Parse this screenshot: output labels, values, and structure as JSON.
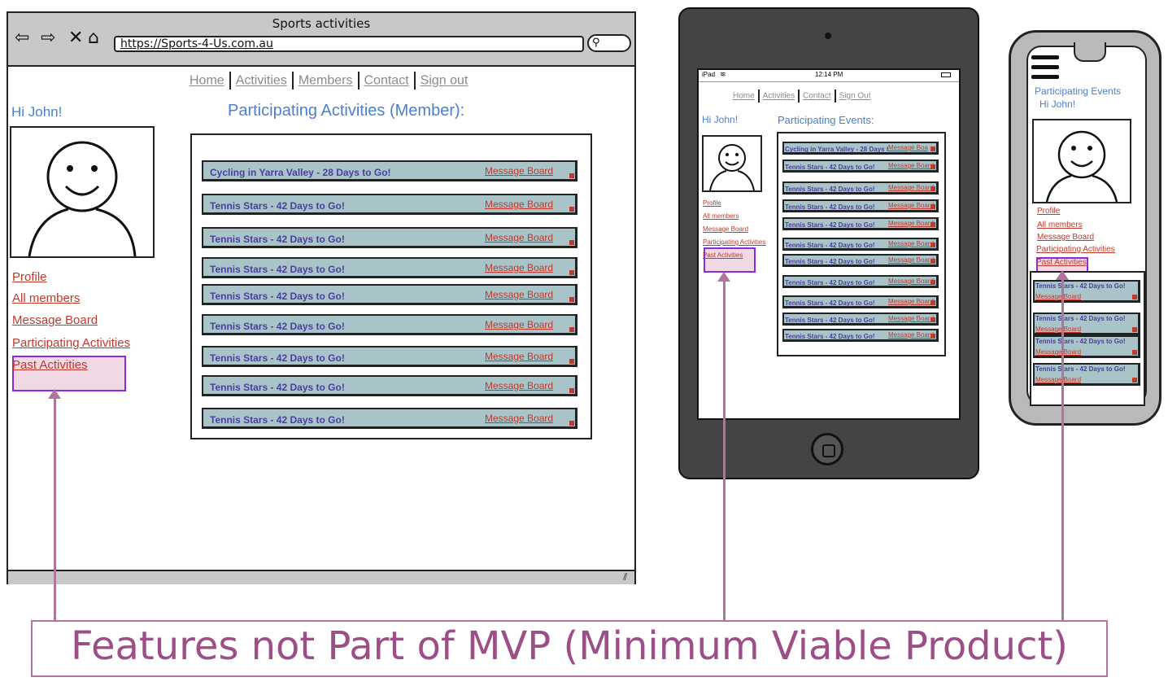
{
  "desktop": {
    "window_title": "Sports activities",
    "url": "https://Sports-4-Us.com.au",
    "icons": [
      "back-arrow-icon",
      "forward-arrow-icon",
      "close-icon",
      "home-icon",
      "search-icon"
    ],
    "nav": [
      "Home",
      "Activities",
      "Members",
      "Contact",
      "Sign out"
    ],
    "greeting": "Hi John!",
    "heading": "Participating Activities (Member):",
    "sidebar": [
      "Profile",
      "All members",
      "Message Board",
      "Participating Activities",
      "Past Activities"
    ],
    "activities": [
      {
        "name": "Cycling in Yarra Valley - 28 Days to Go!",
        "link": "Message Board"
      },
      {
        "name": "Tennis Stars - 42 Days to Go!",
        "link": "Message Board"
      },
      {
        "name": "Tennis Stars - 42 Days to Go!",
        "link": "Message Board"
      },
      {
        "name": "Tennis Stars - 42 Days to Go!",
        "link": "Message Board"
      },
      {
        "name": "Tennis Stars - 42 Days to Go!",
        "link": "Message Board"
      },
      {
        "name": "Tennis Stars - 42 Days to Go!",
        "link": "Message Board"
      },
      {
        "name": "Tennis Stars - 42 Days to Go!",
        "link": "Message Board"
      },
      {
        "name": "Tennis Stars - 42 Days to Go!",
        "link": "Message Board"
      },
      {
        "name": "Tennis Stars - 42 Days to Go!",
        "link": "Message Board"
      }
    ]
  },
  "tablet": {
    "status_left": "iPad",
    "status_time": "12:14 PM",
    "nav": [
      "Home",
      "Activities",
      "Contact",
      "Sign Out"
    ],
    "greeting": "Hi John!",
    "heading": "Participating Events:",
    "sidebar": [
      "Profile",
      "All members",
      "Message Board",
      "Participating Activities",
      "Past Activities"
    ],
    "activities": [
      {
        "name": "Cycling in Yarra Valley - 28 Days t",
        "link": "Message Boa"
      },
      {
        "name": "Tennis Stars - 42 Days to Go!",
        "link": "Message Board"
      },
      {
        "name": "Tennis Stars - 42 Days to Go!",
        "link": "Message Board"
      },
      {
        "name": "Tennis Stars - 42 Days to Go!",
        "link": "Message Board"
      },
      {
        "name": "Tennis Stars - 42 Days to Go!",
        "link": "Message Board"
      },
      {
        "name": "Tennis Stars - 42 Days to Go!",
        "link": "Message Board"
      },
      {
        "name": "Tennis Stars - 42 Days to Go!",
        "link": "Message Board"
      },
      {
        "name": "Tennis Stars - 42 Days to Go!",
        "link": "Message Board"
      },
      {
        "name": "Tennis Stars - 42 Days to Go!",
        "link": "Message Board"
      },
      {
        "name": "Tennis Stars - 42 Days to Go!",
        "link": "Message Board"
      },
      {
        "name": "Tennis Stars - 42 Days to Go!",
        "link": "Message Board"
      }
    ]
  },
  "phone": {
    "heading": "Participating Events",
    "greeting": "Hi John!",
    "sidebar": [
      "Profile",
      "All members",
      "Message Board",
      "Participating Activities",
      "Past Activities"
    ],
    "activities": [
      {
        "name": "Tennis Stars - 42 Days to Go!",
        "link": "Message Board"
      },
      {
        "name": "Tennis Stars - 42 Days to Go!",
        "link": "Message Board"
      },
      {
        "name": "Tennis Stars - 42 Days to Go!",
        "link": "Message Board"
      },
      {
        "name": "Tennis Stars - 42 Days to Go!",
        "link": "Message Board"
      }
    ]
  },
  "annotation": {
    "text": "Features not Part of MVP (Minimum Viable Product)",
    "color": "#9c4f86"
  },
  "colors": {
    "row_fill": "#a9c4c9",
    "row_text": "#4c3e9e",
    "link_red": "#c0392b",
    "heading_blue": "#4a7fd4",
    "highlight_purple": "#8a2be2"
  }
}
